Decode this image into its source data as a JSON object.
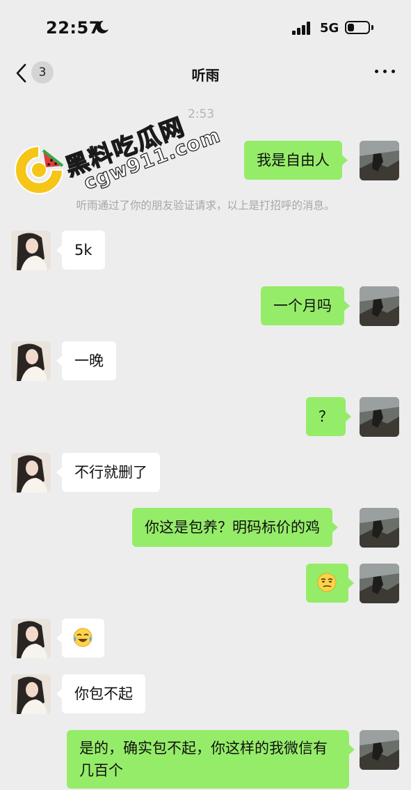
{
  "status_bar": {
    "time": "22:57",
    "network": "5G"
  },
  "nav": {
    "unread_count": "3",
    "title": "听雨"
  },
  "chat": {
    "timestamp_partial": "2:53",
    "system_notice": "听雨通过了你的朋友验证请求，以上是打招呼的消息。",
    "messages": [
      {
        "sender": "me",
        "text": "我是自由人"
      },
      {
        "sender": "them",
        "text": "5k"
      },
      {
        "sender": "me",
        "text": "一个月吗"
      },
      {
        "sender": "them",
        "text": "一晚"
      },
      {
        "sender": "me",
        "text": "？"
      },
      {
        "sender": "them",
        "text": "不行就删了"
      },
      {
        "sender": "me",
        "text": "你这是包养？明码标价的鸡"
      },
      {
        "sender": "me",
        "emoji": "smirk-emoji"
      },
      {
        "sender": "them",
        "emoji": "tears-of-joy-emoji"
      },
      {
        "sender": "them",
        "text": "你包不起"
      },
      {
        "sender": "me",
        "text": "是的，确实包不起，你这样的我微信有几百个"
      }
    ]
  },
  "watermark": {
    "text_cn": "黑料吃瓜网",
    "text_en": "cgw911.com"
  },
  "colors": {
    "background": "#ededed",
    "my_bubble": "#95ec69",
    "their_bubble": "#ffffff",
    "meta_text": "#a6a6a6"
  }
}
